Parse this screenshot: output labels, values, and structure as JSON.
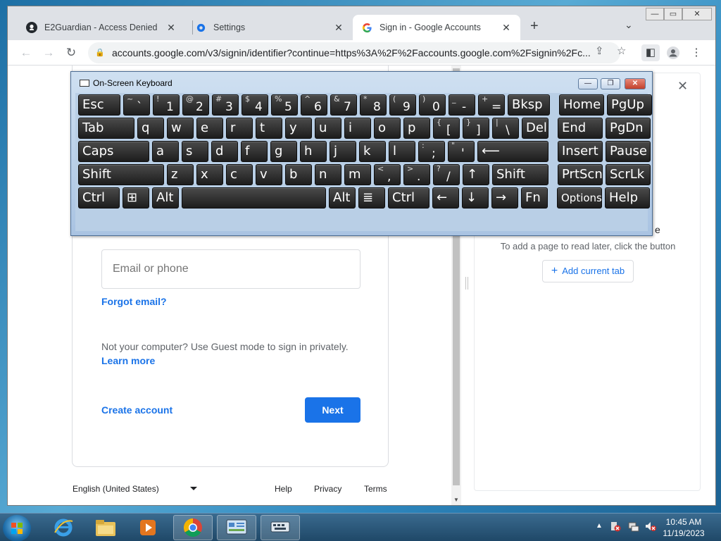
{
  "browser": {
    "tabs": [
      {
        "title": "E2Guardian - Access Denied",
        "icon": "github-icon"
      },
      {
        "title": "Settings",
        "icon": "gear-icon"
      },
      {
        "title": "Sign in - Google Accounts",
        "icon": "google-icon"
      }
    ],
    "url": "accounts.google.com/v3/signin/identifier?continue=https%3A%2F%2Faccounts.google.com%2Fsignin%2Fc..."
  },
  "signin": {
    "email_placeholder": "Email or phone",
    "forgot_email": "Forgot email?",
    "guest_text": "Not your computer? Use Guest mode to sign in privately.",
    "learn_more": "Learn more",
    "create_account": "Create account",
    "next": "Next"
  },
  "footer": {
    "language": "English (United States)",
    "help": "Help",
    "privacy": "Privacy",
    "terms": "Terms"
  },
  "side_panel": {
    "partial_text": "e",
    "hint": "To add a page to read later, click the button",
    "add_button": "Add current tab"
  },
  "osk": {
    "title": "On-Screen Keyboard",
    "rows": [
      [
        {
          "label": "Esc"
        },
        {
          "shift": "~",
          "label": "`"
        },
        {
          "shift": "!",
          "label": "1"
        },
        {
          "shift": "@",
          "label": "2"
        },
        {
          "shift": "#",
          "label": "3"
        },
        {
          "shift": "$",
          "label": "4"
        },
        {
          "shift": "%",
          "label": "5"
        },
        {
          "shift": "^",
          "label": "6"
        },
        {
          "shift": "&",
          "label": "7"
        },
        {
          "shift": "*",
          "label": "8"
        },
        {
          "shift": "(",
          "label": "9"
        },
        {
          "shift": ")",
          "label": "0"
        },
        {
          "shift": "_",
          "label": "-"
        },
        {
          "shift": "+",
          "label": "="
        },
        {
          "label": "Bksp"
        },
        {
          "label": "Home"
        },
        {
          "label": "PgUp"
        }
      ],
      [
        {
          "label": "Tab"
        },
        {
          "label": "q"
        },
        {
          "label": "w"
        },
        {
          "label": "e"
        },
        {
          "label": "r"
        },
        {
          "label": "t"
        },
        {
          "label": "y"
        },
        {
          "label": "u"
        },
        {
          "label": "i"
        },
        {
          "label": "o"
        },
        {
          "label": "p"
        },
        {
          "shift": "{",
          "label": "["
        },
        {
          "shift": "}",
          "label": "]"
        },
        {
          "shift": "|",
          "label": "\\"
        },
        {
          "label": "Del"
        },
        {
          "label": "End"
        },
        {
          "label": "PgDn"
        }
      ],
      [
        {
          "label": "Caps"
        },
        {
          "label": "a"
        },
        {
          "label": "s"
        },
        {
          "label": "d"
        },
        {
          "label": "f"
        },
        {
          "label": "g"
        },
        {
          "label": "h"
        },
        {
          "label": "j"
        },
        {
          "label": "k"
        },
        {
          "label": "l"
        },
        {
          "shift": ":",
          "label": ";"
        },
        {
          "shift": "\"",
          "label": "'"
        },
        {
          "label": "⟵"
        },
        {
          "label": "Insert"
        },
        {
          "label": "Pause"
        }
      ],
      [
        {
          "label": "Shift"
        },
        {
          "label": "z"
        },
        {
          "label": "x"
        },
        {
          "label": "c"
        },
        {
          "label": "v"
        },
        {
          "label": "b"
        },
        {
          "label": "n"
        },
        {
          "label": "m"
        },
        {
          "shift": "<",
          "label": ","
        },
        {
          "shift": ">",
          "label": "."
        },
        {
          "shift": "?",
          "label": "/"
        },
        {
          "label": "↑"
        },
        {
          "label": "Shift"
        },
        {
          "label": "PrtScn"
        },
        {
          "label": "ScrLk"
        }
      ],
      [
        {
          "label": "Ctrl"
        },
        {
          "label": "⊞"
        },
        {
          "label": "Alt"
        },
        {
          "label": ""
        },
        {
          "label": "Alt"
        },
        {
          "label": "≣"
        },
        {
          "label": "Ctrl"
        },
        {
          "label": "←"
        },
        {
          "label": "↓"
        },
        {
          "label": "→"
        },
        {
          "label": "Fn"
        },
        {
          "label": "Options"
        },
        {
          "label": "Help"
        }
      ]
    ]
  },
  "taskbar": {
    "time": "10:45 AM",
    "date": "11/19/2023"
  }
}
